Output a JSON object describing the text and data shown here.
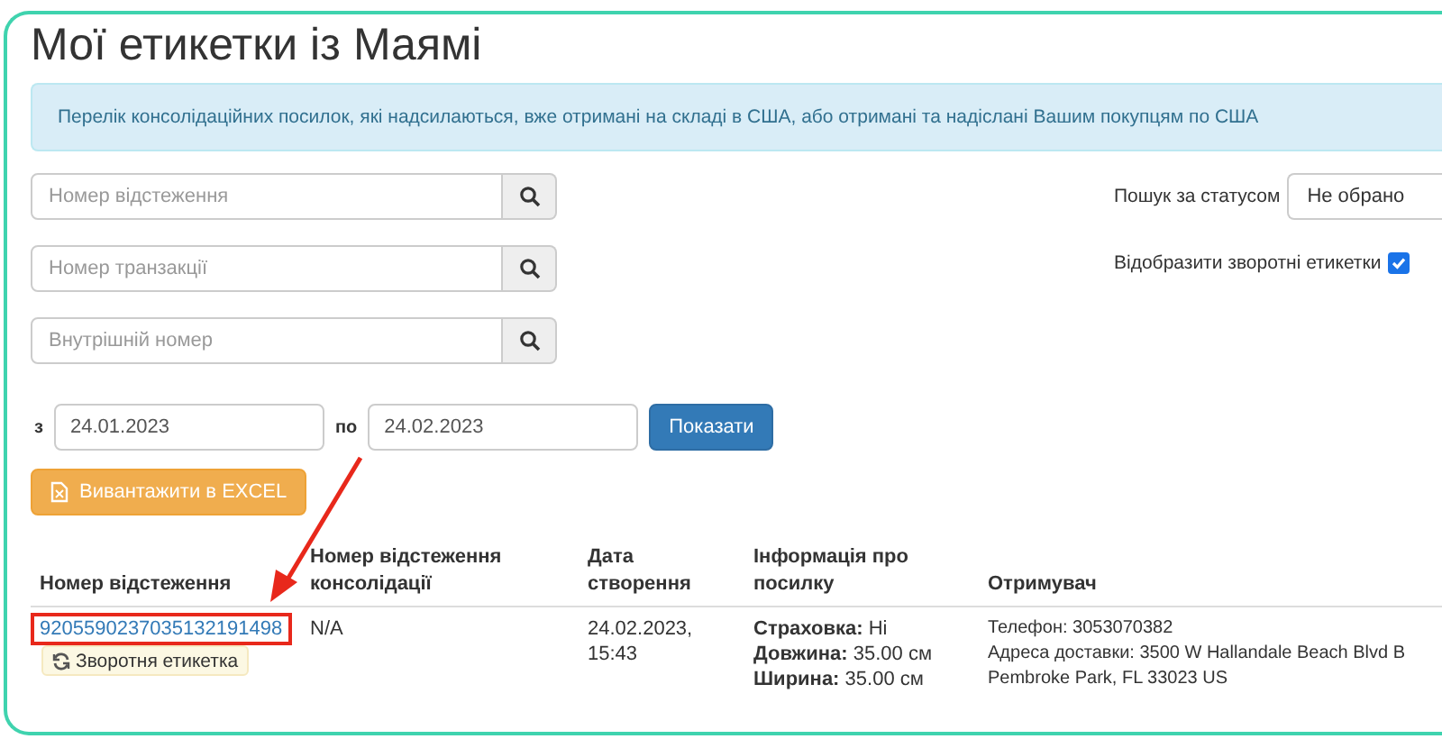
{
  "title": "Мої етикетки із Маямі",
  "notice": "Перелік консолідаційних посилок, які надсилаються, вже отримані на складі в США, або отримані та надіслані Вашим покупцям по США",
  "search_fields": [
    {
      "placeholder": "Номер відстеження"
    },
    {
      "placeholder": "Номер транзакції"
    },
    {
      "placeholder": "Внутрішній номер"
    }
  ],
  "status_filter": {
    "label": "Пошук за статусом",
    "value": "Не обрано"
  },
  "return_labels": {
    "label": "Відобразити зворотні етикетки",
    "checked": true
  },
  "date_range": {
    "from_label": "з",
    "from": "24.01.2023",
    "to_label": "по",
    "to": "24.02.2023",
    "button": "Показати"
  },
  "export_button": "Вивантажити в EXCEL",
  "table": {
    "columns": [
      "Номер відстеження",
      "Номер відстеження консолідації",
      "Дата створення",
      "Інформація про посилку",
      "Отримувач"
    ],
    "rows": [
      {
        "tracking": "9205590237035132191498",
        "annotated": true,
        "return_button": "Зворотня етикетка",
        "consolidation": "N/A",
        "created": "24.02.2023, 15:43",
        "parcel_info": [
          {
            "label": "Страховка:",
            "value": "Ні"
          },
          {
            "label": "Довжина:",
            "value": "35.00 см"
          },
          {
            "label": "Ширина:",
            "value": "35.00 см"
          }
        ],
        "recipient": [
          "Телефон: 3053070382",
          "Адреса доставки: 3500 W Hallandale Beach Blvd B",
          "Pembroke Park, FL 33023 US"
        ]
      }
    ]
  }
}
